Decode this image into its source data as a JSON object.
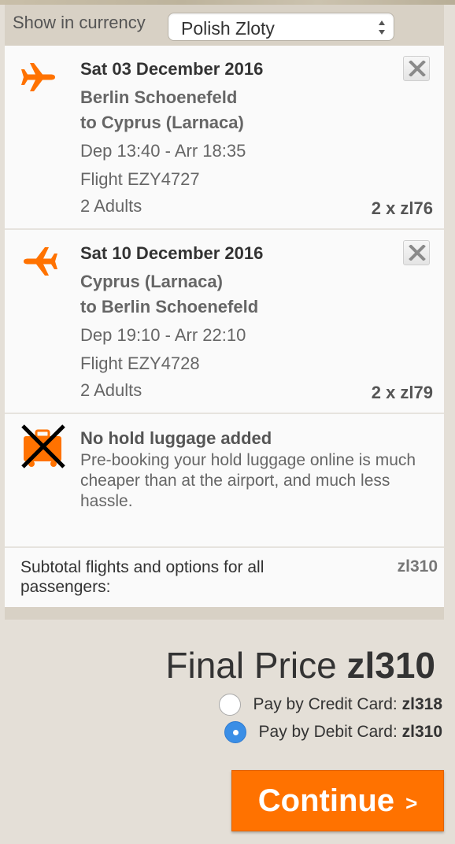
{
  "currency": {
    "label": "Show in currency",
    "selected": "Polish Zloty"
  },
  "flights": [
    {
      "date": "Sat 03 December 2016",
      "route_from": "Berlin Schoenefeld",
      "route_to": "to Cyprus (Larnaca)",
      "times": "Dep 13:40 - Arr 18:35",
      "flight_number": "Flight EZY4727",
      "passengers": "2 Adults",
      "price": "2 x zl76",
      "icon": "plane-outbound-icon"
    },
    {
      "date": "Sat 10 December 2016",
      "route_from": "Cyprus (Larnaca)",
      "route_to": "to Berlin Schoenefeld",
      "times": "Dep 19:10 - Arr 22:10",
      "flight_number": "Flight EZY4728",
      "passengers": "2 Adults",
      "price": "2 x zl79",
      "icon": "plane-return-icon"
    }
  ],
  "luggage": {
    "title": "No hold luggage added",
    "text": "Pre-booking your hold luggage online is much cheaper than at the airport, and much less hassle."
  },
  "subtotal": {
    "label": "Subtotal flights and options for all passengers:",
    "value": "zl310"
  },
  "final_price": {
    "label": "Final Price",
    "amount": "zl310"
  },
  "payment_options": [
    {
      "label": "Pay by Credit Card:",
      "amount": "zl318",
      "selected": false
    },
    {
      "label": "Pay by Debit Card:",
      "amount": "zl310",
      "selected": true
    }
  ],
  "continue_button": {
    "label": "Continue",
    "chevron": ">"
  },
  "colors": {
    "accent": "#ff7200",
    "radio_selected": "#3a8ee6",
    "background": "#e4dfd7"
  }
}
